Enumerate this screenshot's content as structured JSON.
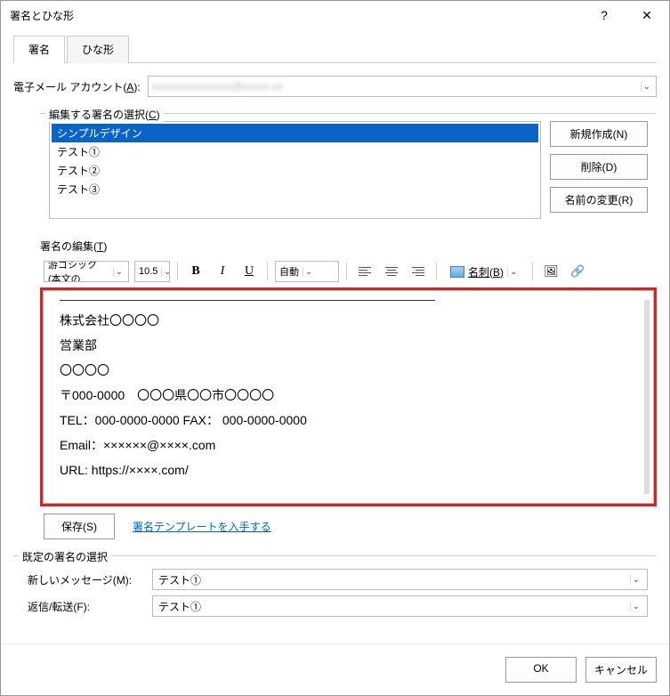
{
  "window": {
    "title": "署名とひな形",
    "help_icon": "?",
    "close_icon": "✕"
  },
  "tabs": {
    "signature": "署名",
    "stationery": "ひな形"
  },
  "account": {
    "label_prefix": "電子メール アカウント(",
    "label_key": "A",
    "label_suffix": "):",
    "value_masked": "xxxxxxxxxxxxxxx@xxxxx.xx"
  },
  "signature_select": {
    "label_prefix": "編集する署名の選択(",
    "label_key": "C",
    "label_suffix": ")",
    "items": [
      "シンプルデザイン",
      "テスト①",
      "テスト②",
      "テスト③"
    ],
    "selected_index": 0,
    "buttons": {
      "new": "新規作成(N)",
      "delete": "削除(D)",
      "rename": "名前の変更(R)"
    }
  },
  "edit": {
    "label_prefix": "署名の編集(",
    "label_key": "T",
    "label_suffix": ")",
    "toolbar": {
      "font": "游ゴシック (本文の",
      "size": "10.5",
      "bold": "B",
      "italic": "I",
      "underline": "U",
      "color_label": "自動",
      "meishi_label": "名刺(B)"
    },
    "content_lines": [
      "株式会社〇〇〇〇",
      "営業部",
      "〇〇〇〇",
      "〒000-0000　〇〇〇県〇〇市〇〇〇〇",
      "TEL：000-0000-0000 FAX： 000-0000-0000",
      "Email：××××××@××××.com",
      "URL: https://××××.com/"
    ],
    "save_label": "保存(S)",
    "template_link": "署名テンプレートを入手する"
  },
  "defaults": {
    "group_label": "既定の署名の選択",
    "new_message_label": "新しいメッセージ(M):",
    "reply_forward_label": "返信/転送(F):",
    "new_message_value": "テスト①",
    "reply_forward_value": "テスト①"
  },
  "footer": {
    "ok": "OK",
    "cancel": "キャンセル"
  }
}
